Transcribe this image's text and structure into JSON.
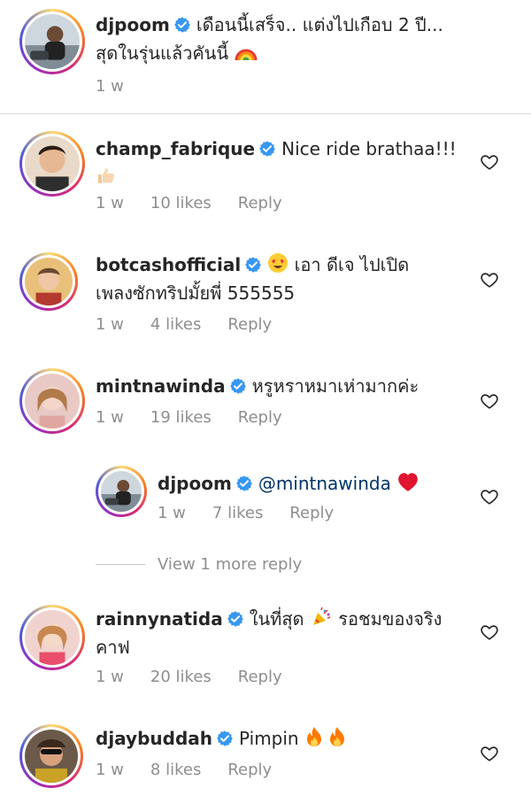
{
  "caption": {
    "username": "djpoom",
    "text_line1": "เดือนนี้เสร็จ.. แต่งไปเกือบ 2 ปี...",
    "text_line2": "สุดในรุ่นแล้วคันนี้",
    "emoji": "rainbow-emoji",
    "time": "1 w"
  },
  "comments": [
    {
      "username": "champ_fabrique",
      "text": "Nice ride brathaa!!!",
      "emoji": "thumbs-up-emoji",
      "time": "1 w",
      "likes": "10 likes",
      "reply": "Reply"
    },
    {
      "username": "botcashofficial",
      "emoji_lead": "heart-eyes-emoji",
      "text_line1": "เอา ดีเจ ไปเปิด",
      "text_line2": "เพลงซักทริปมั้ยพี่ 555555",
      "time": "1 w",
      "likes": "4 likes",
      "reply": "Reply"
    },
    {
      "username": "mintnawinda",
      "text": "หรูหราหมาเห่ามากค่ะ",
      "time": "1 w",
      "likes": "19 likes",
      "reply": "Reply"
    },
    {
      "username": "rainnynatida",
      "text_line1": "ในที่สุด",
      "emoji": "party-popper-emoji",
      "text_line1b": "รอชมของจริง",
      "text_line2": "คาฟ",
      "time": "1 w",
      "likes": "20 likes",
      "reply": "Reply"
    },
    {
      "username": "djaybuddah",
      "text": "Pimpin",
      "emoji": "fire-emoji",
      "time": "1 w",
      "likes": "8 likes",
      "reply": "Reply"
    }
  ],
  "reply": {
    "username": "djpoom",
    "mention": "@mintnawinda",
    "emoji": "red-heart-emoji",
    "time": "1 w",
    "likes": "7 likes",
    "reply": "Reply"
  },
  "view_more": "View 1 more reply",
  "colors": {
    "verified": "#3897f0",
    "muted": "#8e8e8e",
    "text": "#262626",
    "divider": "#dbdbdb"
  }
}
